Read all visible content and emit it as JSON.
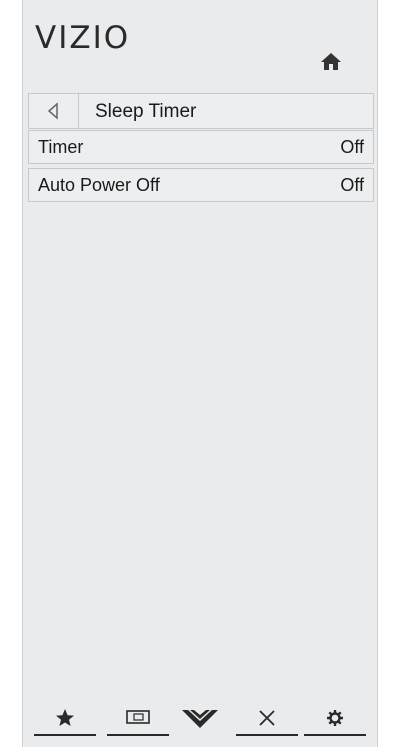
{
  "brand": {
    "logo_text": "VIZIO"
  },
  "header": {
    "title": "Sleep Timer"
  },
  "menu": {
    "items": [
      {
        "label": "Timer",
        "value": "Off"
      },
      {
        "label": "Auto Power Off",
        "value": "Off"
      }
    ]
  },
  "bottom_nav": {
    "items": [
      {
        "icon": "star-icon"
      },
      {
        "icon": "screen-icon"
      },
      {
        "icon": "vizio-v-icon"
      },
      {
        "icon": "close-icon"
      },
      {
        "icon": "gear-icon"
      }
    ]
  },
  "colors": {
    "panel_background": "#e9ebec",
    "row_border": "#c6c9cb",
    "text": "#1a1a1a"
  }
}
